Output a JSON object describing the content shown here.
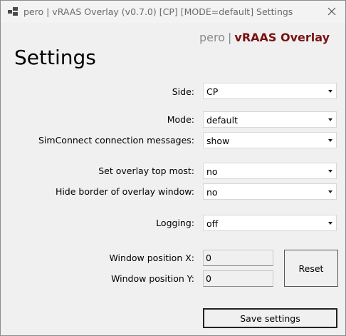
{
  "window": {
    "title": "pero | vRAAS Overlay (v0.7.0)  [CP]  [MODE=default] Settings"
  },
  "brand": {
    "owner": "pero",
    "separator": "|",
    "product": "vRAAS Overlay",
    "product_color": "#7a1212"
  },
  "page": {
    "heading": "Settings"
  },
  "form": {
    "side": {
      "label": "Side:",
      "value": "CP"
    },
    "mode": {
      "label": "Mode:",
      "value": "default"
    },
    "simconnect": {
      "label": "SimConnect connection messages:",
      "value": "show"
    },
    "topmost": {
      "label": "Set overlay top most:",
      "value": "no"
    },
    "hide_border": {
      "label": "Hide border of overlay window:",
      "value": "no"
    },
    "logging": {
      "label": "Logging:",
      "value": "off"
    },
    "pos_x": {
      "label": "Window position X:",
      "value": "0"
    },
    "pos_y": {
      "label": "Window position Y:",
      "value": "0"
    }
  },
  "buttons": {
    "reset": "Reset",
    "save": "Save settings"
  },
  "icons": {
    "app": "app-icon",
    "close": "close-icon",
    "dropdown": "chevron-down-icon"
  }
}
